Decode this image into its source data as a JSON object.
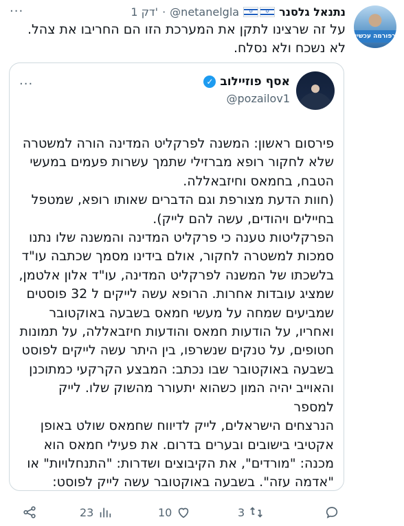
{
  "post": {
    "author": {
      "name": "נתנאל גלסנר",
      "handle": "@netanelgla",
      "flag_icons": [
        "israel-flag-icon",
        "israel-flag-icon"
      ],
      "avatar_caption": "רפורמה עכשיו"
    },
    "dot": "·",
    "age": "1 דק'",
    "text_lines": [
      "על זה שרצינו לתקן את המערכת הזו הם החריבו את צהל.",
      "לא נשכח ולא נסלח."
    ]
  },
  "quote": {
    "author": {
      "name": "אסף פוזיילוב",
      "handle": "@pozailov1",
      "verified": true
    },
    "text_lines": [
      "פירסום ראשון: המשנה לפרקליט המדינה הורה למשטרה",
      "שלא לחקור רופא מברזילי שתמך עשרות פעמים במעשי",
      "הטבח, בחמאס וחיזבאללה.",
      "(חוות הדעת מצורפת וגם הדברים שאותו רופא, שמטפל",
      "בחיילים ויהודים, עשה להם לייק).",
      "הפרקליטות טענה כי פרקליט המדינה והמשנה שלו נתנו",
      "סמכות למשטרה לחקור, אולם בידינו מסמך שכתבה עו\"ד",
      "בלשכתו של המשנה לפרקליט המדינה, עו\"ד אלון אלטמן,",
      "שמציג עובדות אחרות. הרופא עשה לייקים ל 32 פוסטים",
      "שמביעים שמחה על מעשי חמאס בשבעה באוקטובר",
      "ואחריו, על הודעות חמאס והודעות חיזבאללה, על תמונות",
      "חטופים, על טנקים שנשרפו, בין היתר עשה לייקים לפוסט",
      "בשבעה באוקטובר שבו נכתב: המבצע הקרקעי כמתוכנן",
      "והאוייב יהיה המון כשהוא יתעורר מהשוק שלו. לייק למספר",
      "הנרצחים הישראלים, לייק לדיווח שחמאס שולט באופן",
      "אקטיבי בישובים ובערים בדרום. את פעילי חמאס הוא",
      "מכנה: \"מורדים\", את הקיבוצים ושדרות: \"התנחלויות\" או",
      "\"אדמה עזה\". בשבעה באוקטובר עשה לייק לפוסט:"
    ]
  },
  "actions": {
    "reply_icon": "reply-icon",
    "retweet_count": "3",
    "like_count": "10",
    "views_count": "23",
    "share_icon": "share-icon"
  },
  "colors": {
    "text": "#0f1419",
    "secondary": "#536471",
    "verified": "#1d9bf0",
    "border": "#cfd9de"
  }
}
